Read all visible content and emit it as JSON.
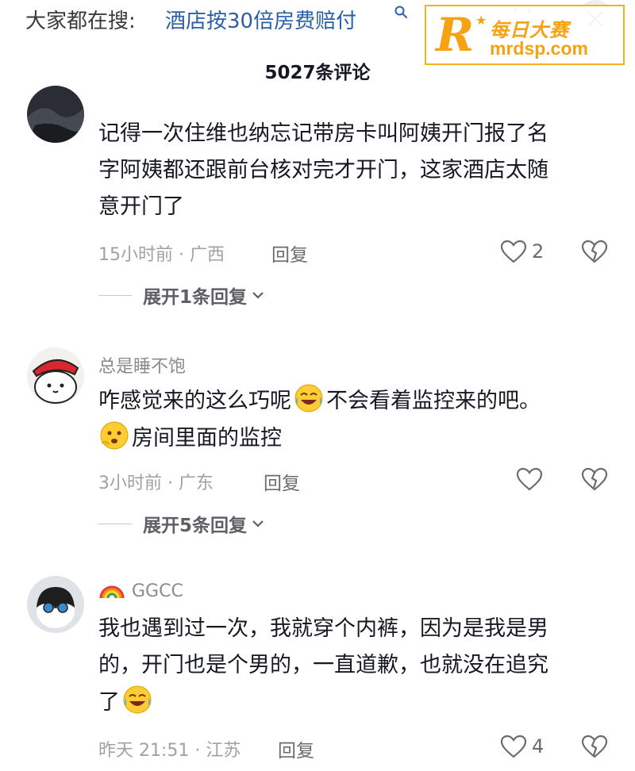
{
  "header": {
    "search_prefix": "大家都在搜:",
    "search_query": "酒店按30倍房费赔付",
    "close_glyph": "✕"
  },
  "watermark": {
    "brand_letter": "R",
    "brand_cn": "每日大赛",
    "brand_url": "mrdsp.com"
  },
  "comments_header": {
    "count_text": "5027条评论"
  },
  "comments": [
    {
      "username": "",
      "text_lines": [
        "记得一次住维也纳忘记带房卡叫阿姨开门报了名",
        "字阿姨都还跟前台核对完才开门，这家酒店太随",
        "意开门了"
      ],
      "meta": "15小时前 · 广西",
      "reply": "回复",
      "likes": "2",
      "expand": "展开1条回复"
    },
    {
      "username": "总是睡不饱",
      "text_a": "咋感觉来的这么巧呢",
      "text_b": "不会看着监控来的吧。",
      "text_c": "房间里面的监控",
      "meta": "3小时前 · 广东",
      "reply": "回复",
      "likes": "",
      "expand": "展开5条回复"
    },
    {
      "username": "GGCC",
      "text_lines": [
        "我也遇到过一次，我就穿个内裤，因为是我是男",
        "的，开门也是个男的，一直道歉，也就没在追究",
        "了"
      ],
      "meta": "昨天 21:51 · 江苏",
      "reply": "回复",
      "likes": "4"
    }
  ],
  "colors": {
    "link": "#2b5fa6",
    "watermark_orange": "#f6a313",
    "text_primary": "#161823",
    "text_secondary": "#a0a1a7"
  }
}
